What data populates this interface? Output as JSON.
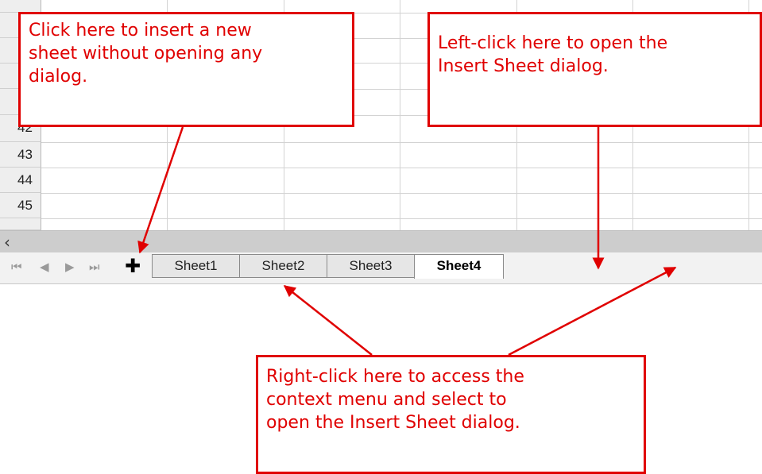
{
  "grid": {
    "row_numbers": [
      "42",
      "43",
      "44",
      "45"
    ]
  },
  "scrollbar": {
    "left_arrow": "‹"
  },
  "navigation": {
    "first": "⏮",
    "prev": "◀",
    "next": "▶",
    "last": "⏭"
  },
  "insert_icon": "✚",
  "tabs": [
    {
      "label": "Sheet1",
      "active": false
    },
    {
      "label": "Sheet2",
      "active": false
    },
    {
      "label": "Sheet3",
      "active": false
    },
    {
      "label": "Sheet4",
      "active": true
    }
  ],
  "callouts": {
    "insert_new": [
      "Click here to insert a new",
      "sheet without opening any",
      "dialog."
    ],
    "left_click": [
      "Left-click here to open the",
      "Insert Sheet dialog."
    ],
    "right_click": [
      "Right-click here to access the",
      "context menu and select to",
      "open the Insert Sheet dialog."
    ]
  },
  "colors": {
    "annotation": "#e00000"
  }
}
